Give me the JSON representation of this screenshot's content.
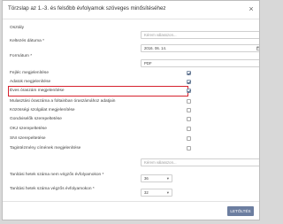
{
  "dialog": {
    "title": "Törzslap az 1.-3. és felsőbb évfolyamok szöveges minősítéséhez",
    "close_glyph": "×"
  },
  "form": {
    "osztaly": {
      "label": "Osztály",
      "placeholder": "Kérem válasszon..."
    },
    "kelt": {
      "label": "Keltezés dátuma *",
      "value": "2016. 06. 14.",
      "icon": "calendar-icon"
    },
    "formatum": {
      "label": "Formátum *",
      "value": "PDF"
    },
    "checkboxes": [
      {
        "label": "Fejléc megjelenítése",
        "checked": true
      },
      {
        "label": "Adatok megjelenítése",
        "checked": true
      },
      {
        "label": "Éves óraszám megjelenítése",
        "checked": true,
        "highlighted": true
      },
      {
        "label": "Mulasztási óraszáma a foltainban óraszámához adatjain",
        "checked": false
      },
      {
        "label": "Közösségi szolgálat megjelenítése",
        "checked": false
      },
      {
        "label": "Gondviselők szerepeltetése",
        "checked": false
      },
      {
        "label": "OKJ szerepeltetése",
        "checked": false
      },
      {
        "label": "SNI szerepeltetése",
        "checked": false
      },
      {
        "label": "Tagintézmény címének megjelenítése",
        "checked": false
      }
    ],
    "tagintezmeny_select": {
      "placeholder": "Kérem válasszon..."
    },
    "kezdo": {
      "label": "Tanítási hetek száma nem végzős évfolyamokon *",
      "value": "36"
    },
    "vegzo": {
      "label": "Tanítási hetek száma végzős évfolyamokon *",
      "value": "32"
    }
  },
  "footer": {
    "download_label": "LETÖLTÉS"
  }
}
